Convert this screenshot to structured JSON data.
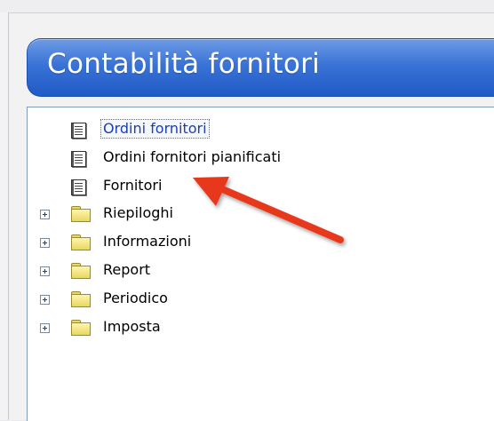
{
  "header": {
    "title": "Contabilità fornitori"
  },
  "tree": {
    "documents": [
      {
        "label": "Ordini fornitori",
        "icon": "document-list-icon",
        "selected": true
      },
      {
        "label": "Ordini fornitori pianificati",
        "icon": "document-list-icon",
        "selected": false
      },
      {
        "label": "Fornitori",
        "icon": "document-list-icon",
        "selected": false
      }
    ],
    "folders": [
      {
        "label": "Riepiloghi",
        "icon": "folder-icon",
        "expander": "expand-plus-icon"
      },
      {
        "label": "Informazioni",
        "icon": "folder-icon",
        "expander": "expand-plus-icon"
      },
      {
        "label": "Report",
        "icon": "folder-icon",
        "expander": "expand-plus-icon"
      },
      {
        "label": "Periodico",
        "icon": "folder-icon",
        "expander": "expand-plus-icon"
      },
      {
        "label": "Imposta",
        "icon": "folder-icon",
        "expander": "expand-plus-icon"
      }
    ]
  },
  "annotation": {
    "arrow_color": "#e8391d",
    "points_to": "Fornitori"
  },
  "colors": {
    "header_gradient_top": "#6e9be6",
    "header_gradient_bottom": "#1f5ac6",
    "selected_text": "#1a3fb4"
  }
}
